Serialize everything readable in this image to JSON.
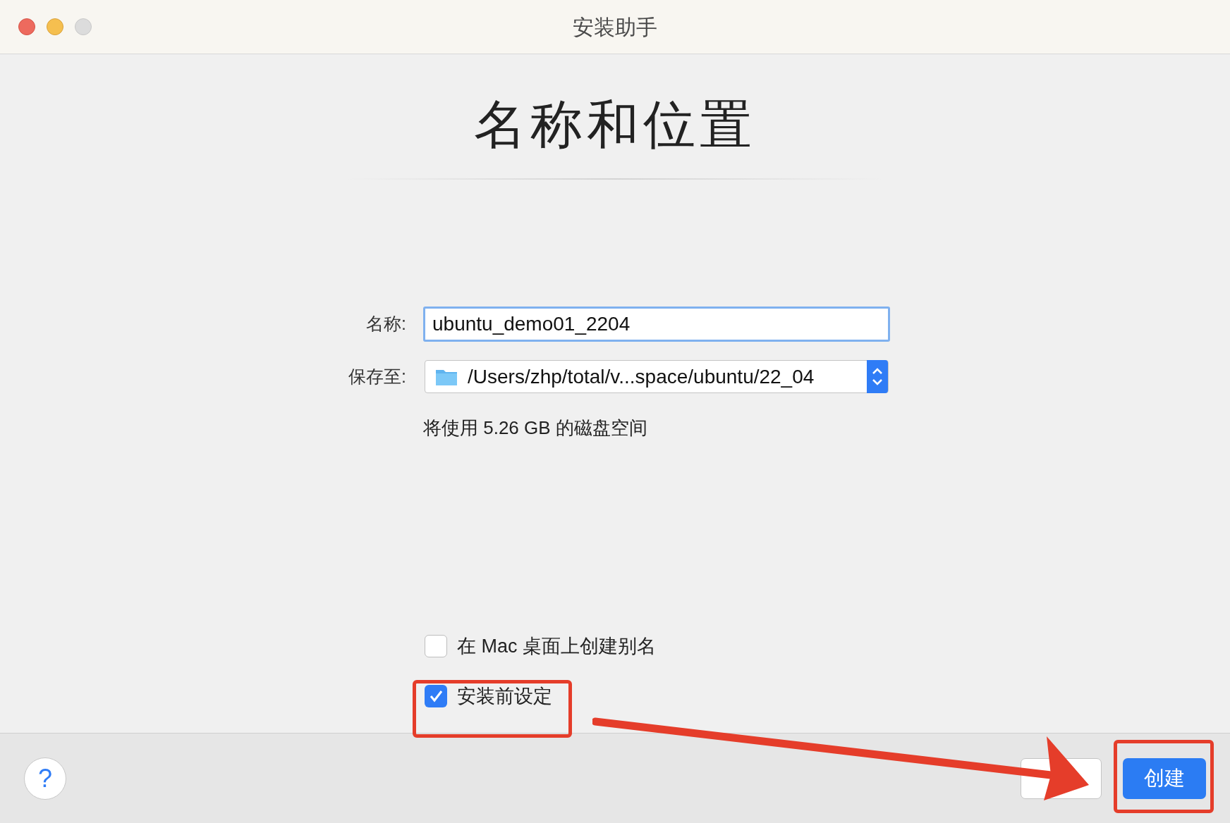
{
  "window": {
    "title": "安装助手"
  },
  "heading": "名称和位置",
  "name_field": {
    "label": "名称:",
    "value": "ubuntu_demo01_2204"
  },
  "save_to": {
    "label": "保存至:",
    "path": "/Users/zhp/total/v...space/ubuntu/22_04"
  },
  "disk_usage": "将使用 5.26 GB 的磁盘空间",
  "options": [
    {
      "label": "在 Mac 桌面上创建别名",
      "checked": false
    },
    {
      "label": "安装前设定",
      "checked": true
    }
  ],
  "footer": {
    "help": "?",
    "primary_button": "创建"
  }
}
